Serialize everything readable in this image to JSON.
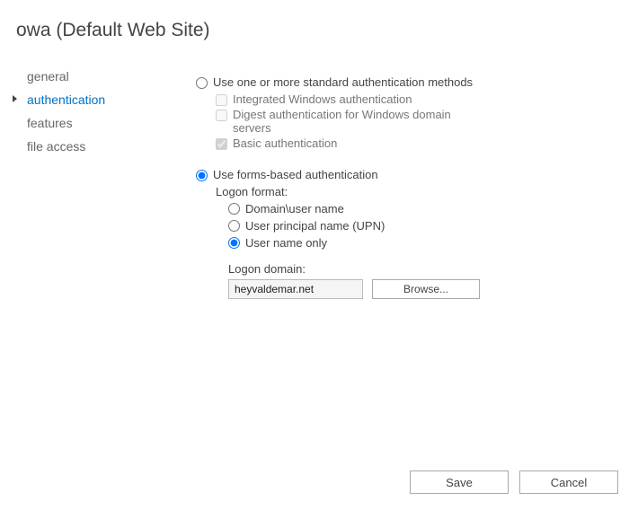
{
  "title": "owa (Default Web Site)",
  "sidebar": {
    "items": [
      {
        "label": "general",
        "active": false
      },
      {
        "label": "authentication",
        "active": true
      },
      {
        "label": "features",
        "active": false
      },
      {
        "label": "file access",
        "active": false
      }
    ]
  },
  "authMethods": {
    "standard": {
      "label": "Use one or more standard authentication methods",
      "selected": false,
      "options": [
        {
          "label": "Integrated Windows authentication",
          "checked": false
        },
        {
          "label": "Digest authentication for Windows domain servers",
          "checked": false
        },
        {
          "label": "Basic authentication",
          "checked": true
        }
      ]
    },
    "forms": {
      "label": "Use forms-based authentication",
      "selected": true,
      "logonFormatLabel": "Logon format:",
      "formats": [
        {
          "label": "Domain\\user name",
          "selected": false
        },
        {
          "label": "User principal name (UPN)",
          "selected": false
        },
        {
          "label": "User name only",
          "selected": true
        }
      ],
      "logonDomainLabel": "Logon domain:",
      "logonDomainValue": "heyvaldemar.net",
      "browseLabel": "Browse..."
    }
  },
  "footer": {
    "save": "Save",
    "cancel": "Cancel"
  }
}
